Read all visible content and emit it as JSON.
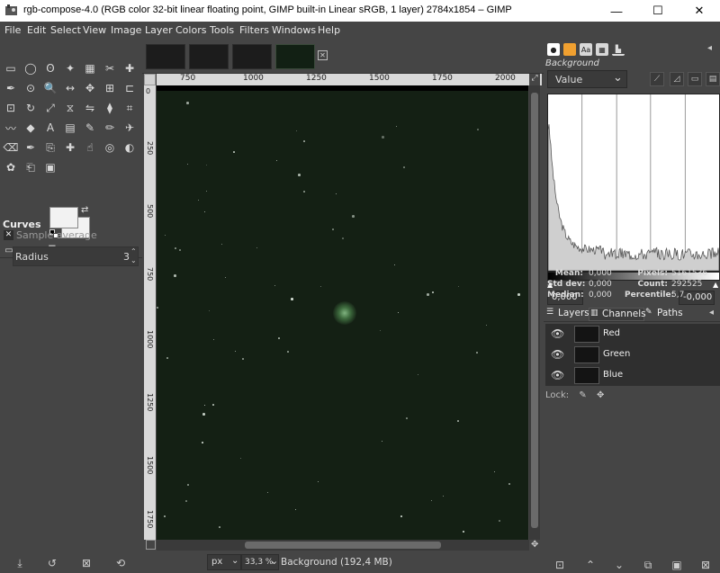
{
  "window": {
    "title": "rgb-compose-4.0 (RGB color 32-bit linear floating point, GIMP built-in Linear sRGB, 1 layer) 2784x1854 – GIMP",
    "minimize": "—",
    "maximize": "☐",
    "close": "✕"
  },
  "menubar": {
    "items": [
      "File",
      "Edit",
      "Select",
      "View",
      "Image",
      "Layer",
      "Colors",
      "Tools",
      "Filters",
      "Windows",
      "Help"
    ]
  },
  "toolbox": {
    "tool_icons": [
      "rect-select-icon",
      "ellipse-select-icon",
      "free-select-icon",
      "fuzzy-select-icon",
      "select-by-color-icon",
      "scissors-icon",
      "foreground-select-icon",
      "paths-icon",
      "color-picker-icon",
      "zoom-icon",
      "measure-icon",
      "move-icon",
      "align-icon",
      "crop-icon",
      "unified-transform-icon",
      "rotate-icon",
      "scale-icon",
      "shear-icon",
      "flip-icon",
      "perspective-icon",
      "cage-icon",
      "warp-icon",
      "bucket-fill-icon",
      "text-icon",
      "blend-icon",
      "paintbrush-icon",
      "pencil-icon",
      "airbrush-icon",
      "eraser-icon",
      "ink-icon",
      "clone-icon",
      "heal-icon",
      "smudge-icon",
      "blur-icon",
      "dodge-icon",
      "mypaint-icon",
      "perspective-clone-icon",
      "mask-icon"
    ]
  },
  "tool_options": {
    "title": "Curves",
    "sample_average_label": "Sample average",
    "radius_label": "Radius",
    "radius_value": "3"
  },
  "ruler": {
    "h_ticks": [
      "750",
      "1000",
      "1250",
      "1500",
      "1750",
      "2000"
    ],
    "v_ticks": [
      "0",
      "250",
      "500",
      "750",
      "1000",
      "1250",
      "1500",
      "1750"
    ]
  },
  "statusbar": {
    "unit": "px",
    "zoom": "33,3 %",
    "info": "Background (192,4 MB)"
  },
  "histogram": {
    "layer_name": "Background",
    "channel": "Value",
    "range_min": "0,000",
    "range_max": "-0,000",
    "stats": {
      "mean_label": "Mean:",
      "mean": "0,000",
      "std_label": "Std dev:",
      "std": "0,000",
      "median_label": "Median:",
      "median": "0,000",
      "pixels_label": "Pixels:",
      "pixels": "5161536",
      "count_label": "Count:",
      "count": "292525",
      "percentile_label": "Percentile:",
      "percentile": "5,7"
    }
  },
  "layers_panel": {
    "tabs": [
      "Layers",
      "Channels",
      "Paths"
    ],
    "channels": [
      {
        "name": "Red"
      },
      {
        "name": "Green"
      },
      {
        "name": "Blue"
      }
    ],
    "lock_label": "Lock:"
  }
}
